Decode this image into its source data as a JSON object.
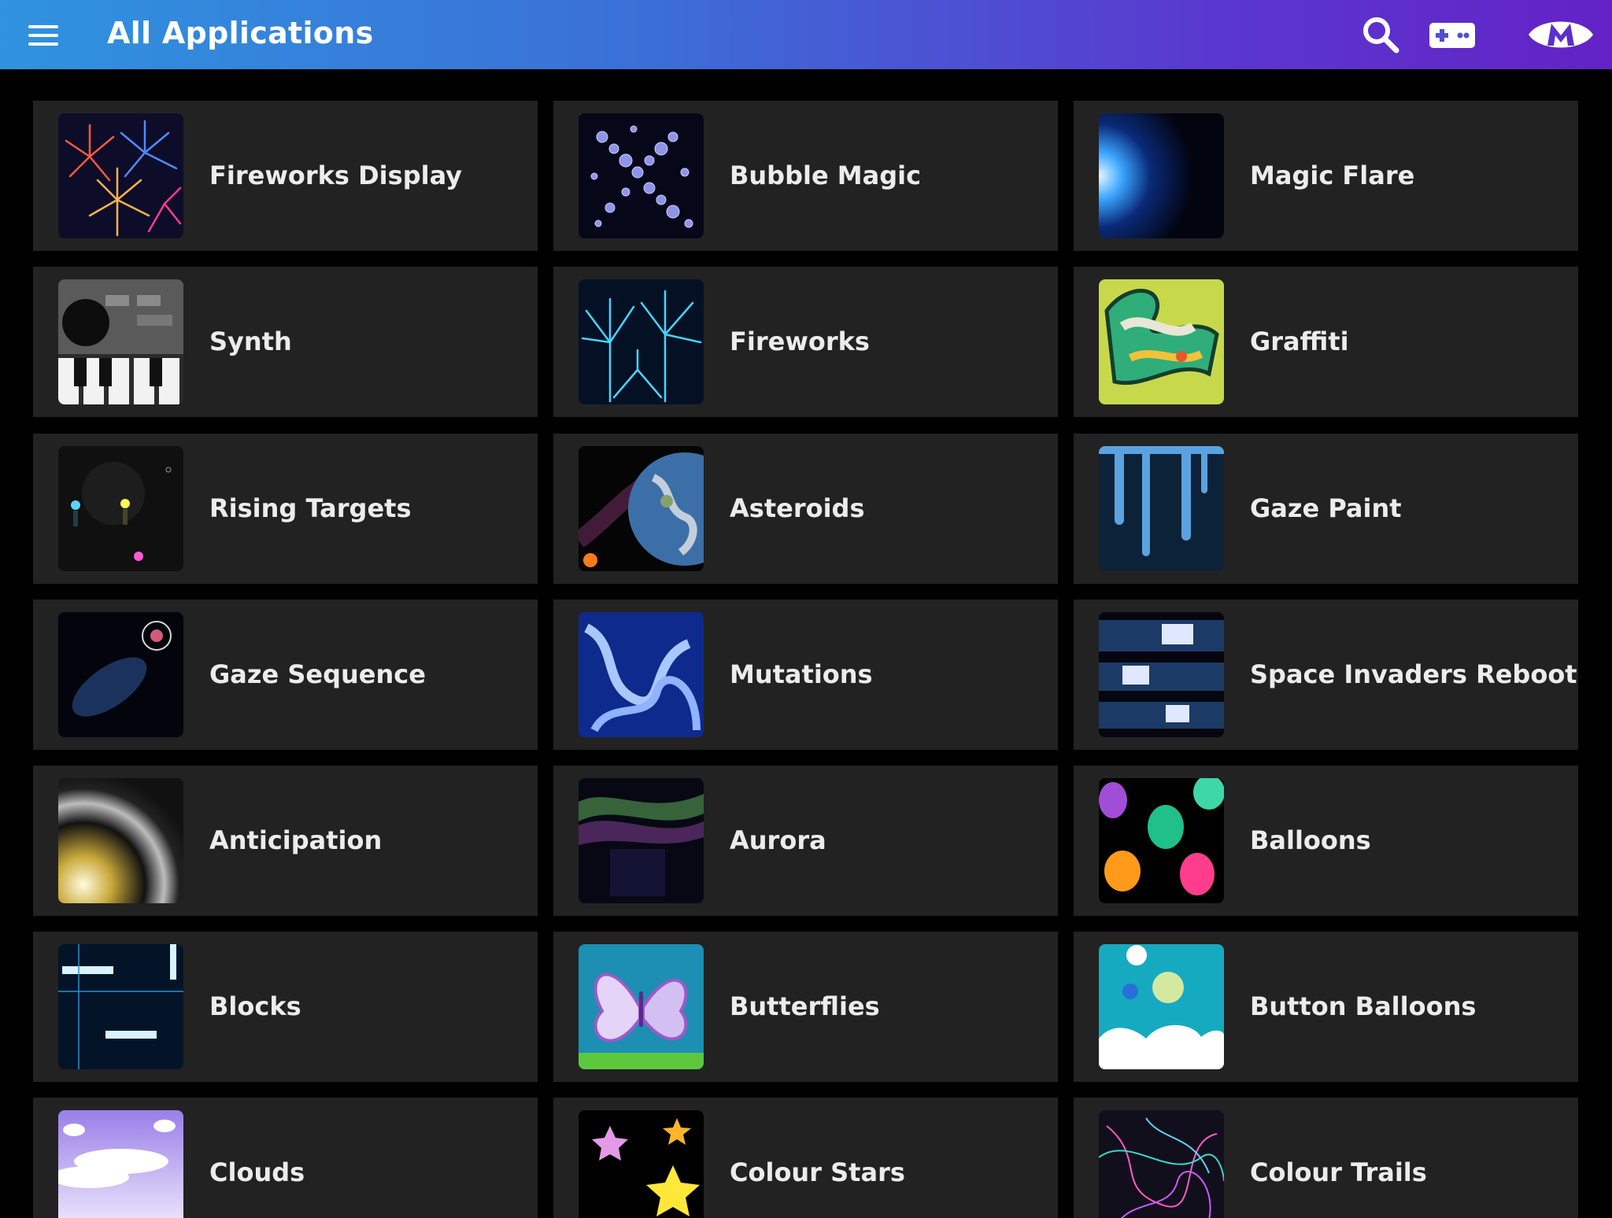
{
  "header": {
    "title": "All Applications",
    "accent_left": "#2f93df",
    "accent_right": "#6322c6",
    "icons": [
      "menu-icon",
      "search-icon",
      "gamepad-icon",
      "m-logo-icon"
    ]
  },
  "apps": [
    {
      "label": "Fireworks Display",
      "thumb": "fireworks-display-thumbnail"
    },
    {
      "label": "Bubble Magic",
      "thumb": "bubble-magic-thumbnail"
    },
    {
      "label": "Magic Flare",
      "thumb": "magic-flare-thumbnail"
    },
    {
      "label": "Synth",
      "thumb": "synth-thumbnail"
    },
    {
      "label": "Fireworks",
      "thumb": "fireworks-thumbnail"
    },
    {
      "label": "Graffiti",
      "thumb": "graffiti-thumbnail"
    },
    {
      "label": "Rising Targets",
      "thumb": "rising-targets-thumbnail"
    },
    {
      "label": "Asteroids",
      "thumb": "asteroids-thumbnail"
    },
    {
      "label": "Gaze Paint",
      "thumb": "gaze-paint-thumbnail"
    },
    {
      "label": "Gaze Sequence",
      "thumb": "gaze-sequence-thumbnail"
    },
    {
      "label": "Mutations",
      "thumb": "mutations-thumbnail"
    },
    {
      "label": "Space Invaders Reboot",
      "thumb": "space-invaders-thumbnail"
    },
    {
      "label": "Anticipation",
      "thumb": "anticipation-thumbnail"
    },
    {
      "label": "Aurora",
      "thumb": "aurora-thumbnail"
    },
    {
      "label": "Balloons",
      "thumb": "balloons-thumbnail"
    },
    {
      "label": "Blocks",
      "thumb": "blocks-thumbnail"
    },
    {
      "label": "Butterflies",
      "thumb": "butterflies-thumbnail"
    },
    {
      "label": "Button Balloons",
      "thumb": "button-balloons-thumbnail"
    },
    {
      "label": "Clouds",
      "thumb": "clouds-thumbnail"
    },
    {
      "label": "Colour Stars",
      "thumb": "colour-stars-thumbnail"
    },
    {
      "label": "Colour Trails",
      "thumb": "colour-trails-thumbnail"
    }
  ]
}
